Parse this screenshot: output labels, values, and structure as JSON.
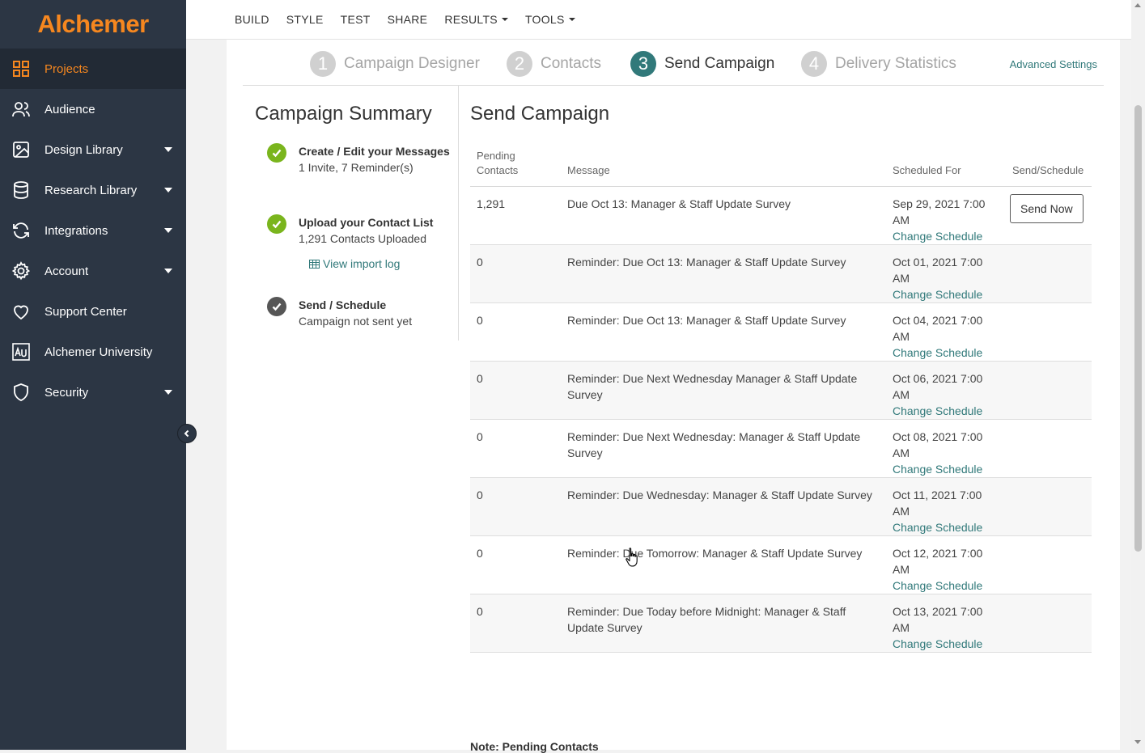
{
  "brand": {
    "logo_text": "Alchemer",
    "accent_color": "#f6871f",
    "sidebar_color": "#2c3644",
    "link_color": "#31797a"
  },
  "sidebar": {
    "items": [
      {
        "label": "Projects",
        "icon": "grid-icon",
        "active": true,
        "has_caret": false
      },
      {
        "label": "Audience",
        "icon": "users-icon",
        "has_caret": false
      },
      {
        "label": "Design Library",
        "icon": "image-icon",
        "has_caret": true
      },
      {
        "label": "Research Library",
        "icon": "database-icon",
        "has_caret": true
      },
      {
        "label": "Integrations",
        "icon": "sync-icon",
        "has_caret": true
      },
      {
        "label": "Account",
        "icon": "gear-icon",
        "has_caret": true
      },
      {
        "label": "Support Center",
        "icon": "heart-icon",
        "has_caret": false
      },
      {
        "label": "Alchemer University",
        "icon": "au-icon",
        "has_caret": false
      },
      {
        "label": "Security",
        "icon": "shield-icon",
        "has_caret": true
      }
    ]
  },
  "topnav": {
    "items": [
      {
        "label": "BUILD"
      },
      {
        "label": "STYLE"
      },
      {
        "label": "TEST"
      },
      {
        "label": "SHARE"
      },
      {
        "label": "RESULTS",
        "dropdown": true
      },
      {
        "label": "TOOLS",
        "dropdown": true
      }
    ]
  },
  "steps": [
    {
      "num": "1",
      "label": "Campaign Designer"
    },
    {
      "num": "2",
      "label": "Contacts"
    },
    {
      "num": "3",
      "label": "Send Campaign",
      "current": true
    },
    {
      "num": "4",
      "label": "Delivery Statistics"
    }
  ],
  "advanced_settings": "Advanced Settings",
  "summary": {
    "title": "Campaign Summary",
    "items": [
      {
        "head": "Create / Edit your Messages",
        "sub": "1 Invite, 7 Reminder(s)",
        "status": "done"
      },
      {
        "head": "Upload your Contact List",
        "sub": "1,291 Contacts Uploaded",
        "status": "done"
      },
      {
        "head": "Send / Schedule",
        "sub": "Campaign not sent yet",
        "status": "pending"
      }
    ],
    "import_log": "View import log"
  },
  "send_campaign": {
    "title": "Send Campaign",
    "columns": {
      "pending": "Pending Contacts",
      "message": "Message",
      "scheduled": "Scheduled For",
      "send": "Send/Schedule"
    },
    "change_label": "Change Schedule",
    "send_now": "Send Now",
    "rows": [
      {
        "pending": "1,291",
        "message": "Due Oct 13: Manager & Staff Update Survey",
        "scheduled": "Sep 29, 2021 7:00 AM"
      },
      {
        "pending": "0",
        "message": "Reminder: Due Oct 13: Manager & Staff Update Survey",
        "scheduled": "Oct 01, 2021 7:00 AM"
      },
      {
        "pending": "0",
        "message": "Reminder: Due Oct 13: Manager & Staff Update Survey",
        "scheduled": "Oct 04, 2021 7:00 AM"
      },
      {
        "pending": "0",
        "message": "Reminder: Due Next Wednesday Manager & Staff Update Survey",
        "scheduled": "Oct 06, 2021 7:00 AM"
      },
      {
        "pending": "0",
        "message": "Reminder: Due Next Wednesday: Manager & Staff Update Survey",
        "scheduled": "Oct 08, 2021 7:00 AM"
      },
      {
        "pending": "0",
        "message": "Reminder: Due Wednesday: Manager & Staff Update Survey",
        "scheduled": "Oct 11, 2021 7:00 AM"
      },
      {
        "pending": "0",
        "message": "Reminder: Due Tomorrow: Manager & Staff Update Survey",
        "scheduled": "Oct 12, 2021 7:00 AM"
      },
      {
        "pending": "0",
        "message": "Reminder: Due Today before Midnight: Manager & Staff Update Survey",
        "scheduled": "Oct 13, 2021 7:00 AM"
      }
    ],
    "note": "Note: Pending Contacts"
  }
}
